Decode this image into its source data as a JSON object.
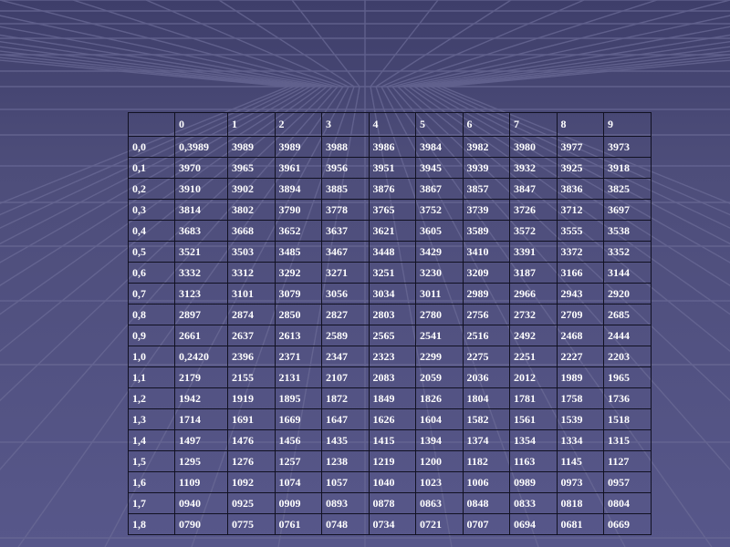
{
  "table": {
    "header": [
      "",
      "0",
      "1",
      "2",
      "3",
      "4",
      "5",
      "6",
      "7",
      "8",
      "9"
    ],
    "rows": [
      [
        "0,0",
        "0,3989",
        "3989",
        "3989",
        "3988",
        "3986",
        "3984",
        "3982",
        "3980",
        "3977",
        "3973"
      ],
      [
        "0,1",
        "3970",
        "3965",
        "3961",
        "3956",
        "3951",
        "3945",
        "3939",
        "3932",
        "3925",
        "3918"
      ],
      [
        "0,2",
        "3910",
        "3902",
        "3894",
        "3885",
        "3876",
        "3867",
        "3857",
        "3847",
        "3836",
        "3825"
      ],
      [
        "0,3",
        "3814",
        "3802",
        "3790",
        "3778",
        "3765",
        "3752",
        "3739",
        "3726",
        "3712",
        "3697"
      ],
      [
        "0,4",
        "3683",
        "3668",
        "3652",
        "3637",
        "3621",
        "3605",
        "3589",
        "3572",
        "3555",
        "3538"
      ],
      [
        "0,5",
        "3521",
        "3503",
        "3485",
        "3467",
        "3448",
        "3429",
        "3410",
        "3391",
        "3372",
        "3352"
      ],
      [
        "0,6",
        "3332",
        "3312",
        "3292",
        "3271",
        "3251",
        "3230",
        "3209",
        "3187",
        "3166",
        "3144"
      ],
      [
        "0,7",
        "3123",
        "3101",
        "3079",
        "3056",
        "3034",
        "3011",
        "2989",
        "2966",
        "2943",
        "2920"
      ],
      [
        "0,8",
        "2897",
        "2874",
        "2850",
        "2827",
        "2803",
        "2780",
        "2756",
        "2732",
        "2709",
        "2685"
      ],
      [
        "0,9",
        "2661",
        "2637",
        "2613",
        "2589",
        "2565",
        "2541",
        "2516",
        "2492",
        "2468",
        "2444"
      ],
      [
        "1,0",
        "0,2420",
        "2396",
        "2371",
        "2347",
        "2323",
        "2299",
        "2275",
        "2251",
        "2227",
        "2203"
      ],
      [
        "1,1",
        "2179",
        "2155",
        "2131",
        "2107",
        "2083",
        "2059",
        "2036",
        "2012",
        "1989",
        "1965"
      ],
      [
        "1,2",
        "1942",
        "1919",
        "1895",
        "1872",
        "1849",
        "1826",
        "1804",
        "1781",
        "1758",
        "1736"
      ],
      [
        "1,3",
        "1714",
        "1691",
        "1669",
        "1647",
        "1626",
        "1604",
        "1582",
        "1561",
        "1539",
        "1518"
      ],
      [
        "1,4",
        "1497",
        "1476",
        "1456",
        "1435",
        "1415",
        "1394",
        "1374",
        "1354",
        "1334",
        "1315"
      ],
      [
        "1,5",
        "1295",
        "1276",
        "1257",
        "1238",
        "1219",
        "1200",
        "1182",
        "1163",
        "1145",
        "1127"
      ],
      [
        "1,6",
        "1109",
        "1092",
        "1074",
        "1057",
        "1040",
        "1023",
        "1006",
        "0989",
        "0973",
        "0957"
      ],
      [
        "1,7",
        "0940",
        "0925",
        "0909",
        "0893",
        "0878",
        "0863",
        "0848",
        "0833",
        "0818",
        "0804"
      ],
      [
        "1,8",
        "0790",
        "0775",
        "0761",
        "0748",
        "0734",
        "0721",
        "0707",
        "0694",
        "0681",
        "0669"
      ]
    ]
  },
  "colors": {
    "background": "#4d4d7a",
    "grid_line": "#6a6a96",
    "text": "#ffffff",
    "border": "#111122"
  }
}
